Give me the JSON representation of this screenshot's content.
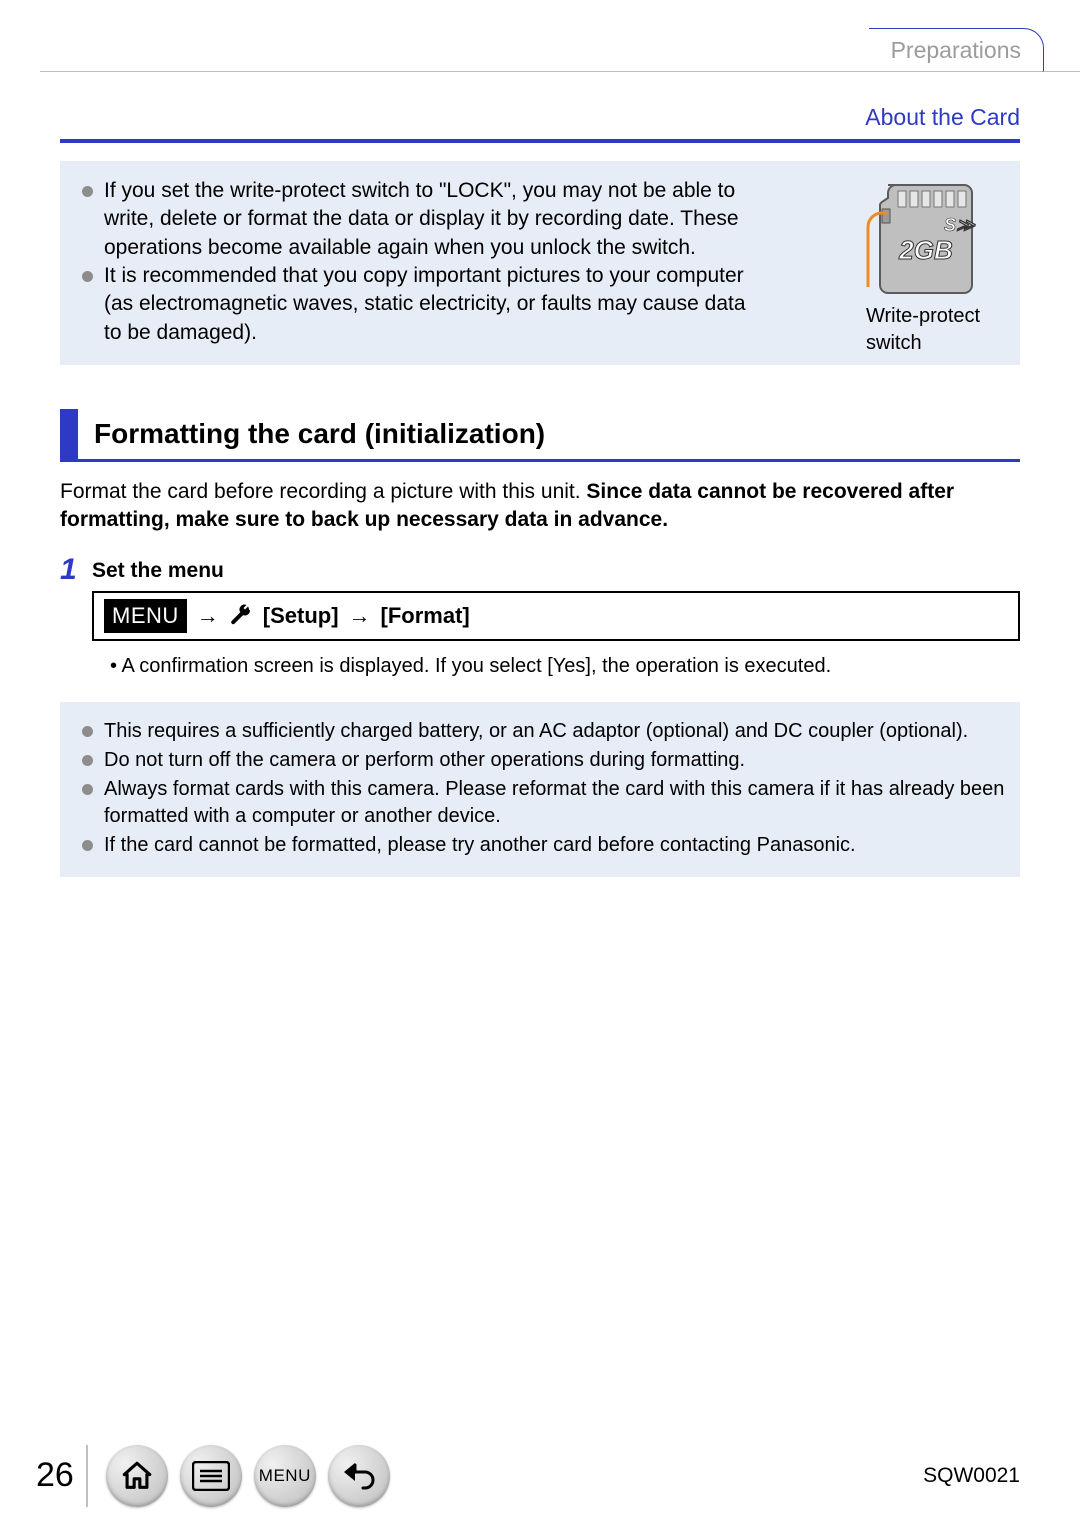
{
  "header": {
    "breadcrumb": "Preparations"
  },
  "chapter_link": "About the Card",
  "notebox1": {
    "items": [
      "If you set the write-protect switch to \"LOCK\", you may not be able to write, delete or format the data or display it by recording date. These operations become available again when you unlock the switch.",
      "It is recommended that you copy important pictures to your computer (as electromagnetic waves, static electricity, or faults may cause data to be damaged)."
    ],
    "sd_capacity": "2GB",
    "sd_caption": "Write-protect switch"
  },
  "section": {
    "title": "Formatting the card (initialization)",
    "intro_plain": "Format the card before recording a picture with this unit. ",
    "intro_bold": "Since data cannot be recovered after formatting, make sure to back up necessary data in advance."
  },
  "step": {
    "number": "1",
    "title": "Set the menu",
    "menu_chip": "MENU",
    "arrow": "→",
    "path_setup": "[Setup]",
    "path_format": "[Format]",
    "subnote": "A confirmation screen is displayed. If you select [Yes], the operation is executed."
  },
  "notebox2": {
    "items": [
      "This requires a sufficiently charged battery, or an AC adaptor (optional) and DC coupler (optional).",
      "Do not turn off the camera or perform other operations during formatting.",
      "Always format cards with this camera. Please reformat the card with this camera if it has already been formatted with a computer or another device.",
      "If the card cannot be formatted, please try another card before contacting Panasonic."
    ]
  },
  "footer": {
    "page": "26",
    "nav_menu_label": "MENU",
    "doc_code": "SQW0021"
  }
}
